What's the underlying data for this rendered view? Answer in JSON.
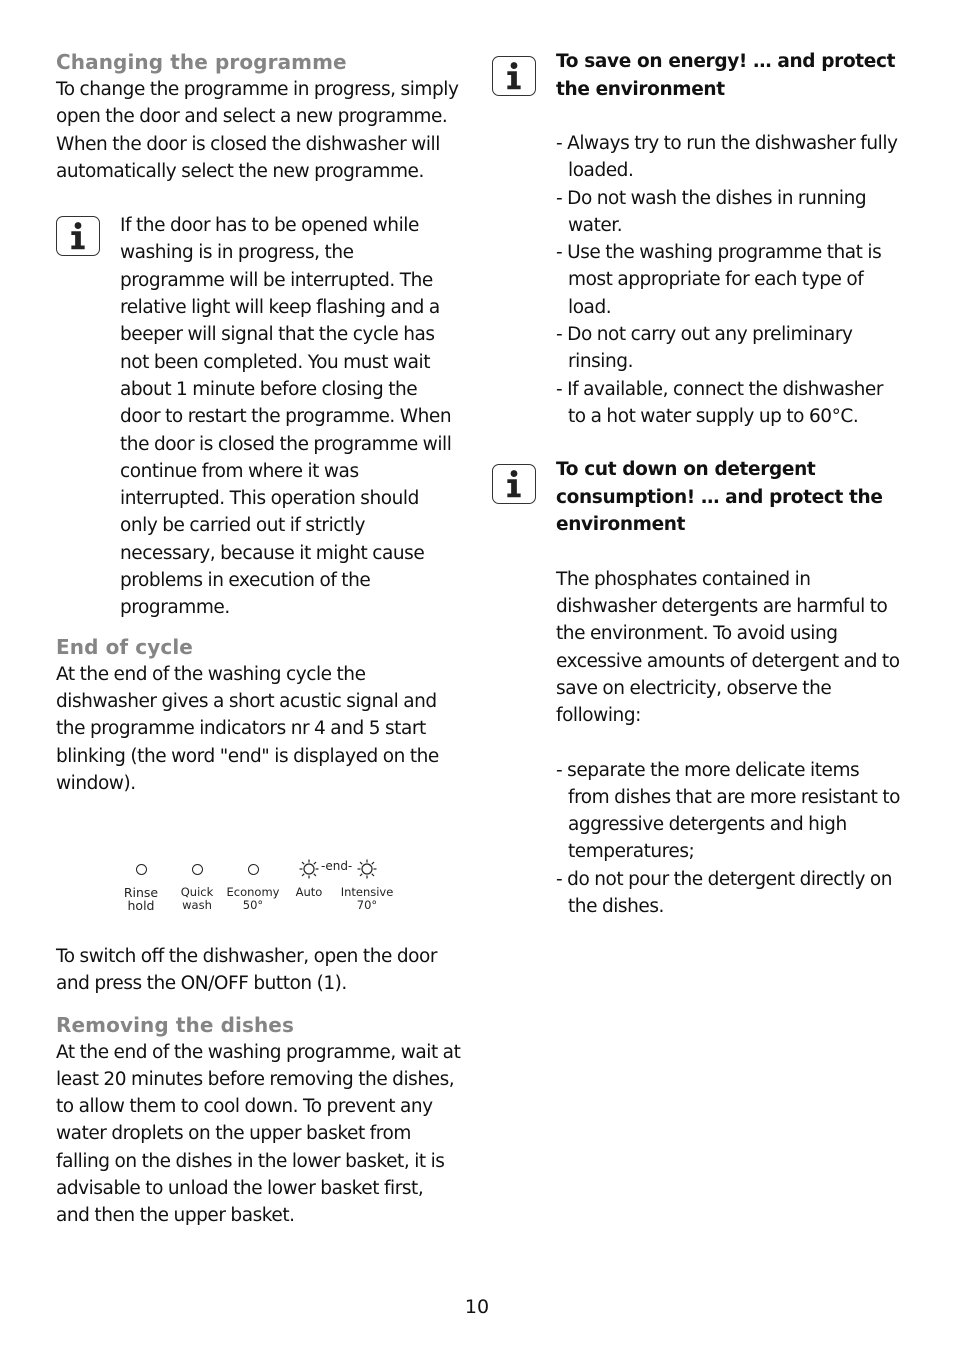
{
  "left_column": {
    "changing": {
      "heading": "Changing the programme",
      "body": "To change the programme in progress, simply open the door and select a new programme. When the door is closed the dishwasher will automatically select the new programme."
    },
    "door_note": {
      "icon": "info-icon",
      "body": "If the door has to be opened while washing is in progress, the programme will be interrupted. The relative light will keep flashing and a beeper will signal that the cycle has not been completed. You must wait about 1 minute before closing the door to restart the programme. When the door is closed the programme will continue from where it was interrupted. This operation should only be carried out if strictly necessary, because it might cause problems in execution of the programme."
    },
    "end_of_cycle": {
      "heading": "End of cycle",
      "body": "At the end of the washing cycle the dishwasher gives a short acustic signal and the programme indicators nr 4 and 5 start blinking (the word \"end\" is displayed on the window)."
    },
    "indicators": {
      "end_text": "-end-",
      "items": [
        {
          "label_line1": "Rinse",
          "label_line2": "hold",
          "lamp": "off"
        },
        {
          "label_line1": "Quick",
          "label_line2": "wash",
          "lamp": "off"
        },
        {
          "label_line1": "Economy",
          "label_line2": "50°",
          "lamp": "off"
        },
        {
          "label_line1": "Auto",
          "label_line2": "",
          "lamp": "blinking"
        },
        {
          "label_line1": "Intensive",
          "label_line2": "70°",
          "lamp": "blinking"
        }
      ]
    },
    "switch_off": {
      "body": "To switch off the dishwasher, open the door and press the ON/OFF button (1)."
    },
    "removing": {
      "heading": "Removing the dishes",
      "body": "At the end of the washing programme, wait at least 20 minutes before removing the dishes, to allow them to cool down. To prevent any water droplets on the upper basket from falling on the dishes in the lower basket, it is advisable to unload the lower basket first, and then the upper basket."
    }
  },
  "right_column": {
    "energy_note": {
      "icon": "info-icon",
      "title": "To save on energy! … and protect the environment",
      "items": [
        "- Always try to run the dishwasher fully loaded.",
        "- Do not wash the dishes in running water.",
        "- Use the washing programme that is most appropriate for each type of load.",
        "- Do not carry out any preliminary rinsing.",
        "- If available, connect the dishwasher to a hot water supply up to 60°C."
      ]
    },
    "detergent_note": {
      "icon": "info-icon",
      "title": "To cut down on detergent consumption! … and protect the environment",
      "body": "The phosphates contained in dishwasher detergents are harmful to the environment. To avoid using excessive amounts of detergent and to save on electricity, observe the following:",
      "items": [
        "- separate the more delicate items from dishes that are more resistant to aggressive detergents and high temperatures;",
        "- do not pour  the detergent directly on the dishes."
      ]
    }
  },
  "page_number": "10",
  "colors": {
    "heading_grey": "#858585",
    "text": "#111111"
  }
}
